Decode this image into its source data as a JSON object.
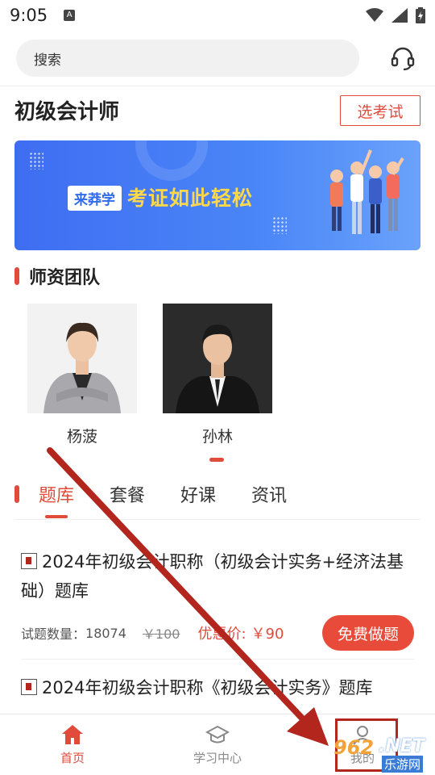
{
  "status_bar": {
    "time": "9:05"
  },
  "search": {
    "placeholder": "搜索"
  },
  "header": {
    "title": "初级会计师",
    "select_button": "选考试"
  },
  "banner": {
    "brand": "来莽学",
    "slogan": "考证如此轻松"
  },
  "teachers_section": {
    "title": "师资团队",
    "teachers": [
      {
        "name": "杨菠"
      },
      {
        "name": "孙林"
      }
    ]
  },
  "tabs": [
    {
      "label": "题库",
      "active": true
    },
    {
      "label": "套餐",
      "active": false
    },
    {
      "label": "好课",
      "active": false
    },
    {
      "label": "资讯",
      "active": false
    }
  ],
  "question_banks": [
    {
      "title": "2024年初级会计职称（初级会计实务+经济法基础）题库",
      "count_label": "试题数量：",
      "count": "18074",
      "original_price": "￥100",
      "sale_label": "优惠价:",
      "sale_price": "￥90",
      "button": "免费做题"
    },
    {
      "title": "2024年初级会计职称《初级会计实务》题库"
    }
  ],
  "bottom_nav": [
    {
      "label": "首页",
      "icon": "home-icon",
      "active": true
    },
    {
      "label": "学习中心",
      "icon": "graduation-cap-icon",
      "active": false
    },
    {
      "label": "我的",
      "icon": "profile-icon",
      "active": false
    }
  ],
  "watermark": {
    "brand": "962",
    "domain": ".NET",
    "site": "乐游网"
  },
  "colors": {
    "accent": "#e14b3b",
    "banner": "#4a86f7",
    "annotation": "#b3261e"
  }
}
